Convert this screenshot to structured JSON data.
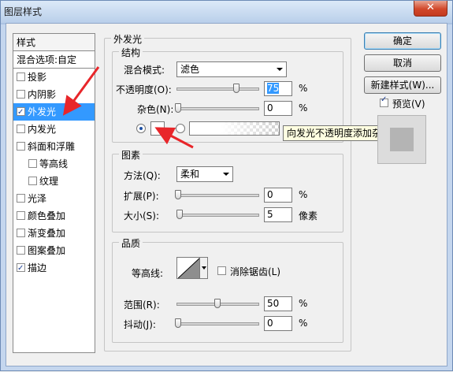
{
  "window": {
    "title": "图层样式",
    "close_glyph": "✕"
  },
  "style_list": {
    "header": "样式",
    "blend_options": "混合选项:自定",
    "items": [
      {
        "label": "投影",
        "checked": false,
        "sub": false,
        "selected": false
      },
      {
        "label": "内阴影",
        "checked": false,
        "sub": false,
        "selected": false
      },
      {
        "label": "外发光",
        "checked": true,
        "sub": false,
        "selected": true
      },
      {
        "label": "内发光",
        "checked": false,
        "sub": false,
        "selected": false
      },
      {
        "label": "斜面和浮雕",
        "checked": false,
        "sub": false,
        "selected": false
      },
      {
        "label": "等高线",
        "checked": false,
        "sub": true,
        "selected": false
      },
      {
        "label": "纹理",
        "checked": false,
        "sub": true,
        "selected": false
      },
      {
        "label": "光泽",
        "checked": false,
        "sub": false,
        "selected": false
      },
      {
        "label": "颜色叠加",
        "checked": false,
        "sub": false,
        "selected": false
      },
      {
        "label": "渐变叠加",
        "checked": false,
        "sub": false,
        "selected": false
      },
      {
        "label": "图案叠加",
        "checked": false,
        "sub": false,
        "selected": false
      },
      {
        "label": "描边",
        "checked": true,
        "sub": false,
        "selected": false
      }
    ]
  },
  "outer_glow": {
    "title": "外发光",
    "structure": {
      "title": "结构",
      "blend_mode_label": "混合模式:",
      "blend_mode_value": "滤色",
      "opacity_label": "不透明度(O):",
      "opacity_value": "75",
      "opacity_unit": "%",
      "opacity_level": 0.75,
      "noise_label": "杂色(N):",
      "noise_value": "0",
      "noise_unit": "%",
      "noise_level": 0,
      "tooltip": "向发光不透明度添加杂色"
    },
    "elements": {
      "title": "图素",
      "method_label": "方法(Q):",
      "method_value": "柔和",
      "spread_label": "扩展(P):",
      "spread_value": "0",
      "spread_unit": "%",
      "spread_level": 0,
      "size_label": "大小(S):",
      "size_value": "5",
      "size_unit": "像素",
      "size_level": 0.02
    },
    "quality": {
      "title": "品质",
      "contour_label": "等高线:",
      "anti_alias_label": "消除锯齿(L)",
      "anti_alias_checked": false,
      "range_label": "范围(R):",
      "range_value": "50",
      "range_unit": "%",
      "range_level": 0.5,
      "jitter_label": "抖动(J):",
      "jitter_value": "0",
      "jitter_unit": "%",
      "jitter_level": 0
    }
  },
  "buttons": {
    "ok": "确定",
    "cancel": "取消",
    "new_style": "新建样式(W)...",
    "preview_label": "预览(V)",
    "preview_checked": true
  },
  "colors": {
    "selection": "#3399ff",
    "arrow": "#e8262a"
  }
}
